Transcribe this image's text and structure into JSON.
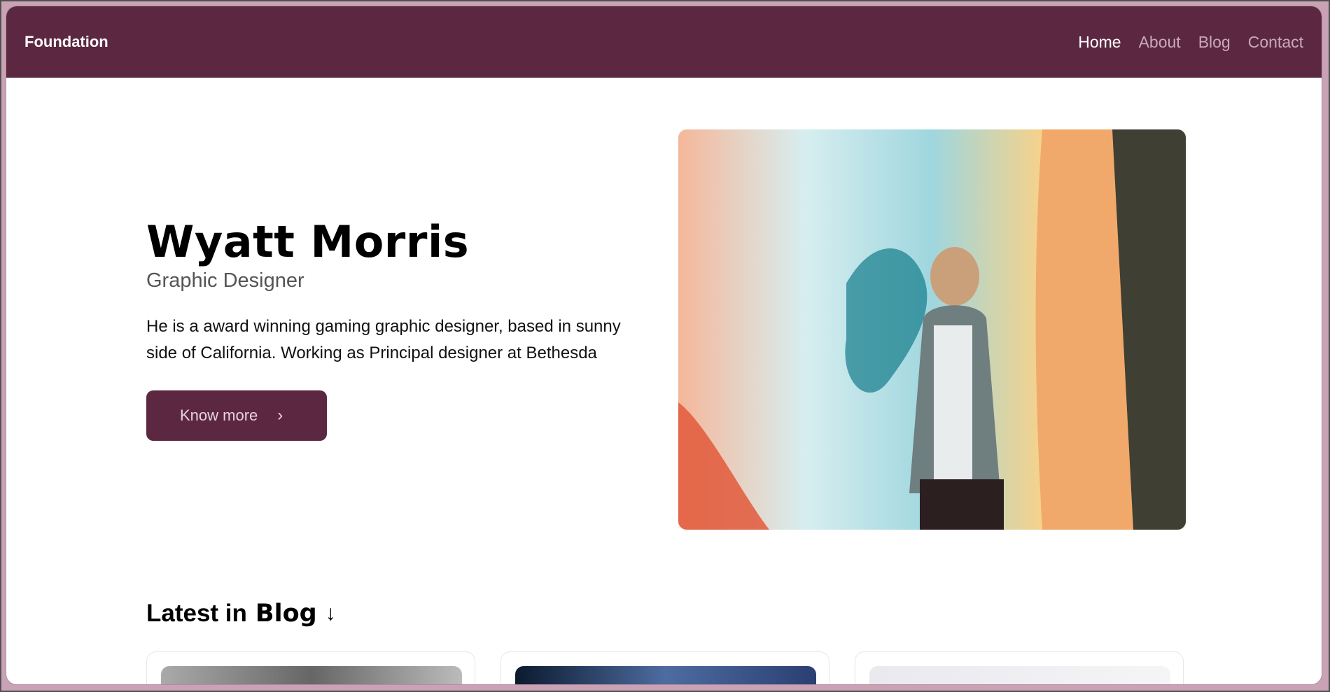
{
  "header": {
    "brand": "Foundation",
    "nav": [
      {
        "label": "Home",
        "active": true
      },
      {
        "label": "About",
        "active": false
      },
      {
        "label": "Blog",
        "active": false
      },
      {
        "label": "Contact",
        "active": false
      }
    ]
  },
  "hero": {
    "name": "Wyatt Morris",
    "role": "Graphic Designer",
    "description": "He is a award winning gaming graphic designer, based in sunny side of California. Working as Principal designer at Bethesda",
    "cta_label": "Know more",
    "cta_icon": "chevron-right-icon"
  },
  "blog": {
    "heading_prefix": "Latest in",
    "heading_strong": "Blog",
    "heading_icon": "arrow-down-icon",
    "cards": [
      {
        "thumb": "statue-photo"
      },
      {
        "thumb": "dark-blue-photo"
      },
      {
        "thumb": "light-grey-photo"
      }
    ]
  },
  "colors": {
    "brand": "#5c2841",
    "nav_inactive": "#c9a9b8",
    "text": "#000000"
  }
}
